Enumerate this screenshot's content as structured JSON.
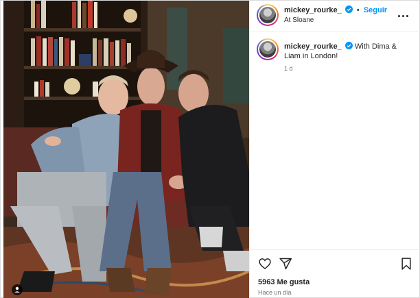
{
  "post": {
    "username": "mickey_rourke_",
    "follow_label": "Seguir",
    "location": "At Sloane",
    "caption_username": "mickey_rourke_",
    "caption_text": "With Dima & Liam in London!",
    "time_ago": "1 d",
    "likes": "5963 Me gusta",
    "posted_ago": "Hace un día"
  },
  "colors": {
    "accent": "#0095f6",
    "verified": "#0095f6",
    "text": "#262626",
    "muted": "#737373"
  },
  "icons": {
    "verified": "verified-badge-icon",
    "more": "more-options-icon",
    "like": "heart-icon",
    "share": "send-icon",
    "save": "bookmark-icon",
    "tag": "user-tag-icon"
  }
}
